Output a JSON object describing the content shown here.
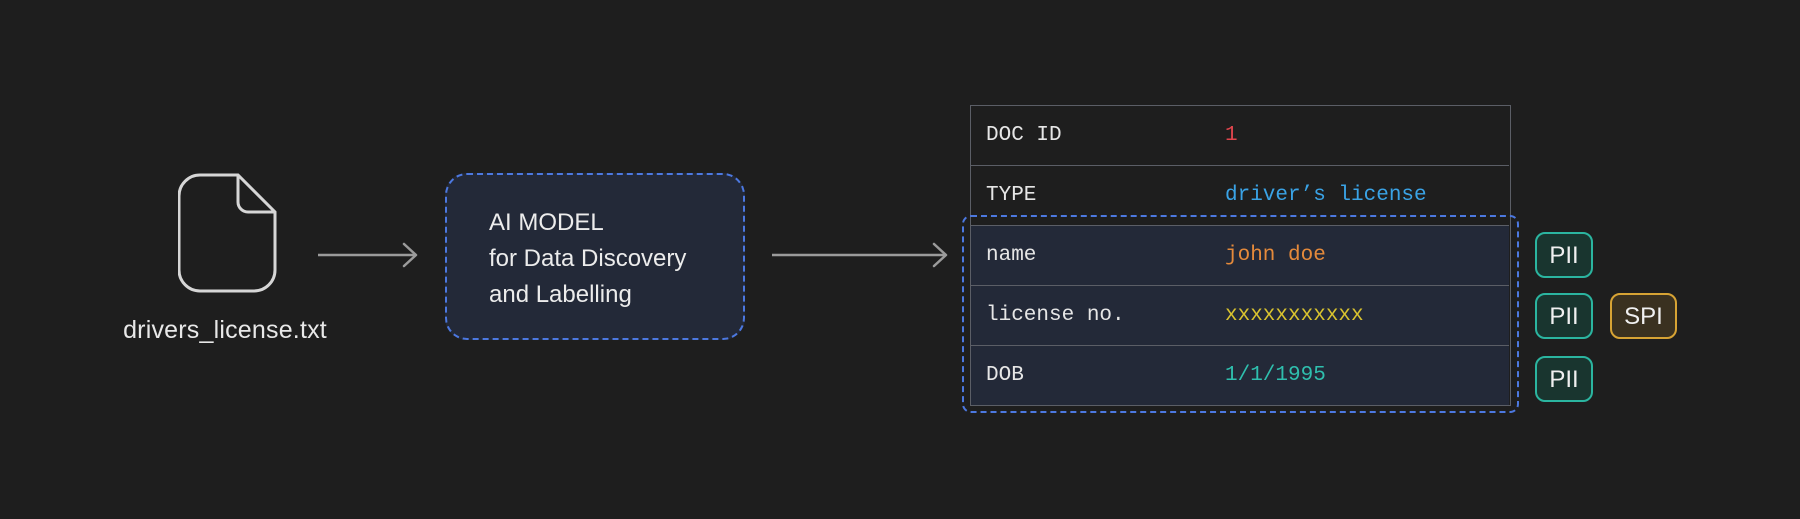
{
  "source_file": {
    "name": "drivers_license.txt",
    "icon": "document-icon"
  },
  "model": {
    "lines": [
      "AI MODEL",
      "for Data Discovery",
      "and Labelling"
    ]
  },
  "table": {
    "rows": [
      {
        "key": "DOC ID",
        "value": "1",
        "value_color": "#e0454d"
      },
      {
        "key": "TYPE",
        "value": "driver’s license",
        "value_color": "#3aa3e6"
      },
      {
        "key": "name",
        "value": "john doe",
        "value_color": "#e58a3b"
      },
      {
        "key": "license no.",
        "value": "xxxxxxxxxxx",
        "value_color": "#d9c32f"
      },
      {
        "key": "DOB",
        "value": "1/1/1995",
        "value_color": "#2fbfae"
      }
    ]
  },
  "labels": {
    "name_row": [
      "PII"
    ],
    "license_row": [
      "PII",
      "SPI"
    ],
    "dob_row": [
      "PII"
    ]
  },
  "colors": {
    "accent_dashed": "#4c78e0",
    "pii_border": "#2bb5a0",
    "spi_border": "#d7a334"
  }
}
